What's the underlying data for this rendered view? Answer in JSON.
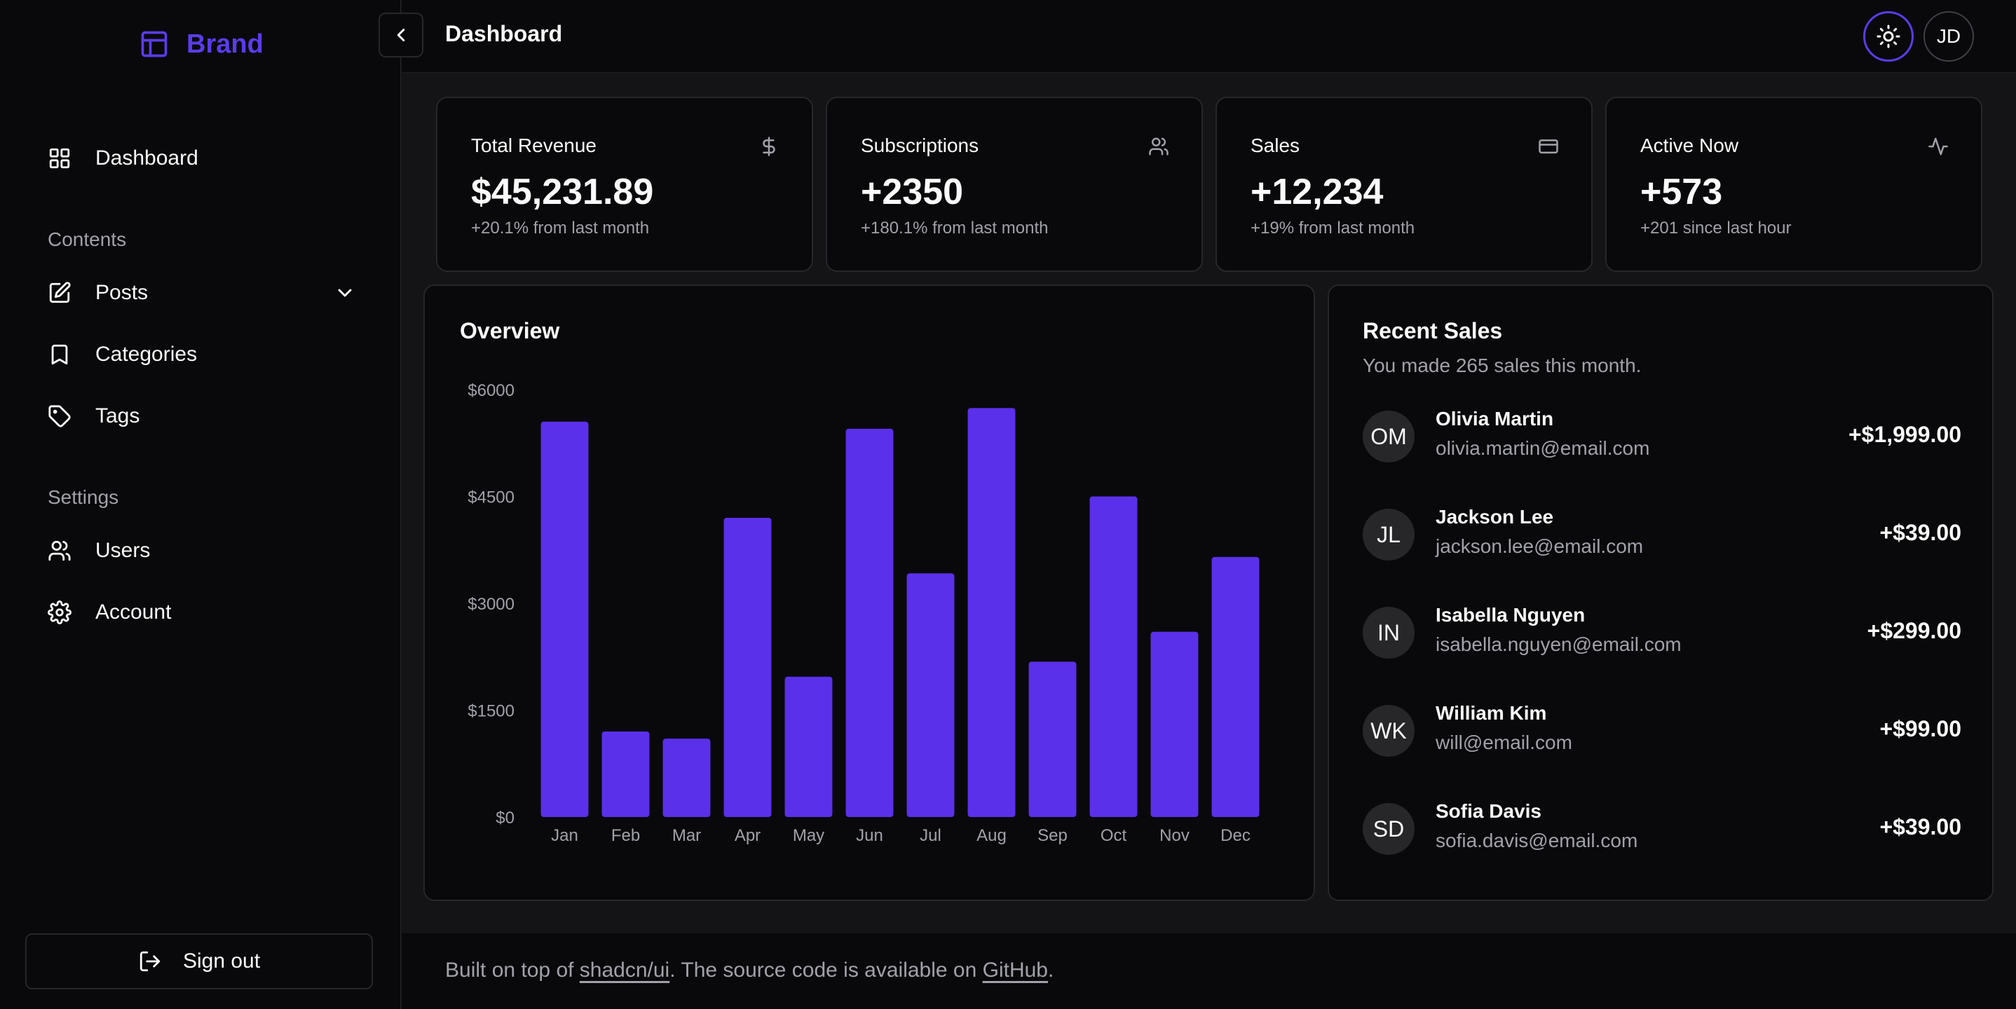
{
  "brand": {
    "name": "Brand",
    "icon": "layout-icon",
    "color": "#5b3cea"
  },
  "header": {
    "title": "Dashboard",
    "avatar_initials": "JD",
    "theme_icon": "sun-icon"
  },
  "sidebar": {
    "items": [
      {
        "label": "Dashboard",
        "icon": "grid-icon"
      },
      {
        "section": "Contents"
      },
      {
        "label": "Posts",
        "icon": "edit-icon"
      },
      {
        "label": "Categories",
        "icon": "bookmark-icon"
      },
      {
        "label": "Tags",
        "icon": "tag-icon"
      },
      {
        "section": "Settings"
      },
      {
        "label": "Users",
        "icon": "users-icon"
      },
      {
        "label": "Account",
        "icon": "gear-icon"
      }
    ],
    "signout_label": "Sign out"
  },
  "stats": [
    {
      "title": "Total Revenue",
      "value": "$45,231.89",
      "sub": "+20.1% from last month",
      "icon": "dollar-icon"
    },
    {
      "title": "Subscriptions",
      "value": "+2350",
      "sub": "+180.1% from last month",
      "icon": "users-icon"
    },
    {
      "title": "Sales",
      "value": "+12,234",
      "sub": "+19% from last month",
      "icon": "credit-card-icon"
    },
    {
      "title": "Active Now",
      "value": "+573",
      "sub": "+201 since last hour",
      "icon": "activity-icon"
    }
  ],
  "overview": {
    "title": "Overview"
  },
  "chart_data": {
    "type": "bar",
    "title": "Overview",
    "categories": [
      "Jan",
      "Feb",
      "Mar",
      "Apr",
      "May",
      "Jun",
      "Jul",
      "Aug",
      "Sep",
      "Oct",
      "Nov",
      "Dec"
    ],
    "values": [
      5550,
      1200,
      1100,
      4200,
      1970,
      5450,
      3420,
      5740,
      2180,
      4500,
      2600,
      3650
    ],
    "yticks": [
      "$0",
      "$1500",
      "$3000",
      "$4500",
      "$6000"
    ],
    "ylim": [
      0,
      6000
    ],
    "color": "#5b30ea",
    "grid": false
  },
  "recent_sales": {
    "title": "Recent Sales",
    "subtitle": "You made 265 sales this month.",
    "rows": [
      {
        "initials": "OM",
        "name": "Olivia Martin",
        "email": "olivia.martin@email.com",
        "amount": "+$1,999.00"
      },
      {
        "initials": "JL",
        "name": "Jackson Lee",
        "email": "jackson.lee@email.com",
        "amount": "+$39.00"
      },
      {
        "initials": "IN",
        "name": "Isabella Nguyen",
        "email": "isabella.nguyen@email.com",
        "amount": "+$299.00"
      },
      {
        "initials": "WK",
        "name": "William Kim",
        "email": "will@email.com",
        "amount": "+$99.00"
      },
      {
        "initials": "SD",
        "name": "Sofia Davis",
        "email": "sofia.davis@email.com",
        "amount": "+$39.00"
      }
    ]
  },
  "footer": {
    "text_before": "Built on top of ",
    "link1": "shadcn/ui",
    "text_middle": ". The source code is available on ",
    "link2": "GitHub",
    "text_after": "."
  }
}
